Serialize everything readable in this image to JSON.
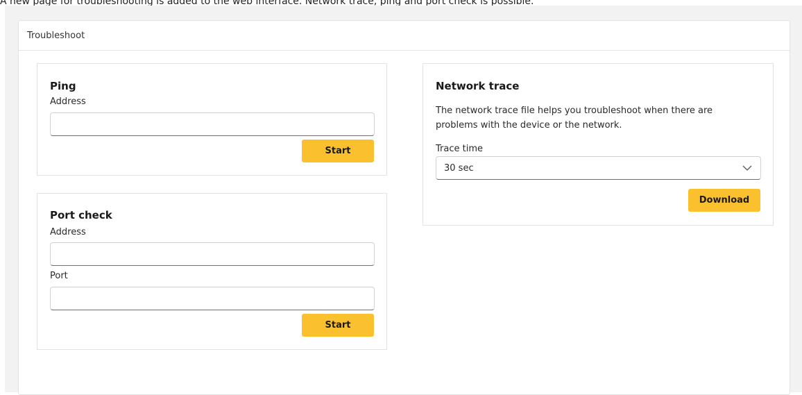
{
  "caption": "A new page for troubleshooting is added to the web interface. Network trace, ping and port check is possible.",
  "page": {
    "title": "Troubleshoot"
  },
  "ping": {
    "title": "Ping",
    "address_label": "Address",
    "address_value": "",
    "start_label": "Start"
  },
  "port_check": {
    "title": "Port check",
    "address_label": "Address",
    "address_value": "",
    "port_label": "Port",
    "port_value": "",
    "start_label": "Start"
  },
  "network_trace": {
    "title": "Network trace",
    "description": "The network trace file helps you troubleshoot when there are problems with the device or the network.",
    "trace_time_label": "Trace time",
    "trace_time_value": "30 sec",
    "download_label": "Download"
  },
  "colors": {
    "accent": "#fbc02d",
    "background": "#f2f2f2",
    "card": "#ffffff"
  },
  "icons": {
    "select_chevron": "chevron-down-icon"
  }
}
